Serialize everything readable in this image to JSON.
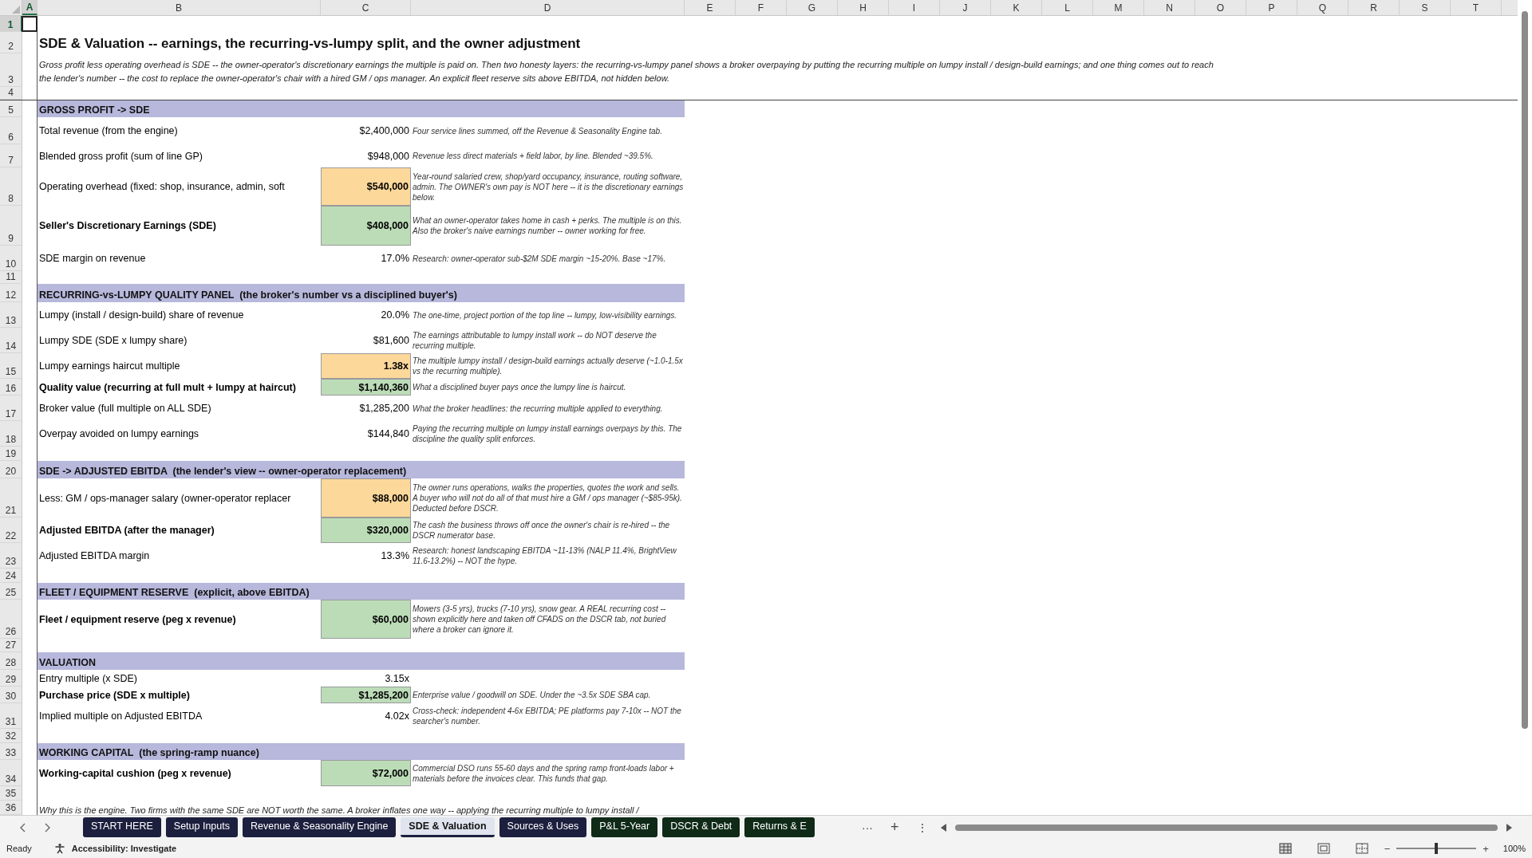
{
  "columns": [
    {
      "label": "A",
      "selected": true
    },
    {
      "label": "B",
      "selected": false
    },
    {
      "label": "C",
      "selected": false
    },
    {
      "label": "D",
      "selected": false
    },
    {
      "label": "E",
      "selected": false
    },
    {
      "label": "F",
      "selected": false
    },
    {
      "label": "G",
      "selected": false
    },
    {
      "label": "H",
      "selected": false
    },
    {
      "label": "I",
      "selected": false
    },
    {
      "label": "J",
      "selected": false
    },
    {
      "label": "K",
      "selected": false
    },
    {
      "label": "L",
      "selected": false
    },
    {
      "label": "M",
      "selected": false
    },
    {
      "label": "N",
      "selected": false
    },
    {
      "label": "O",
      "selected": false
    },
    {
      "label": "P",
      "selected": false
    },
    {
      "label": "Q",
      "selected": false
    },
    {
      "label": "R",
      "selected": false
    },
    {
      "label": "S",
      "selected": false
    },
    {
      "label": "T",
      "selected": false
    }
  ],
  "rows": [
    {
      "number": "1",
      "selected": true,
      "kind": "blank"
    },
    {
      "number": "2",
      "selected": false,
      "kind": "title",
      "text": "SDE & Valuation -- earnings, the recurring-vs-lumpy split, and the owner adjustment"
    },
    {
      "number": "3",
      "selected": false,
      "kind": "intro",
      "text": "Gross profit less operating overhead is SDE -- the owner-operator's discretionary earnings the multiple is paid on. Then two honesty layers: the recurring-vs-lumpy panel shows a broker overpaying by putting the recurring multiple on lumpy install / design-build earnings; and one thing comes out to reach the lender's number -- the cost to replace the owner-operator's chair with a hired GM / ops manager. An explicit fleet reserve sits above EBITDA, not hidden below."
    },
    {
      "number": "4",
      "selected": false,
      "kind": "divider"
    },
    {
      "number": "5",
      "selected": false,
      "kind": "section",
      "text": "GROSS PROFIT -> SDE"
    },
    {
      "number": "6",
      "selected": false,
      "kind": "line",
      "label": "Total revenue (from the engine)",
      "bold": false,
      "value": "$2,400,000",
      "note": "Four service lines summed, off the Revenue & Seasonality Engine tab."
    },
    {
      "number": "7",
      "selected": false,
      "kind": "line",
      "label": "Blended gross profit (sum of line GP)",
      "bold": false,
      "value": "$948,000",
      "note": "Revenue less direct materials + field labor, by line. Blended ~39.5%."
    },
    {
      "number": "8",
      "selected": false,
      "kind": "input-line",
      "label": "Operating overhead (fixed: shop, insurance, admin, soft",
      "bold": false,
      "value": "$540,000",
      "note": "Year-round salaried crew, shop/yard occupancy, insurance, routing software, admin. The OWNER's own pay is NOT here -- it is the discretionary earnings below."
    },
    {
      "number": "9",
      "selected": false,
      "kind": "output-line",
      "label": "Seller's Discretionary Earnings (SDE)",
      "bold": true,
      "value": "$408,000",
      "note": "What an owner-operator takes home in cash + perks. The multiple is on this. Also the broker's naive earnings number -- owner working for free."
    },
    {
      "number": "10",
      "selected": false,
      "kind": "line",
      "label": "SDE margin on revenue",
      "bold": false,
      "value": "17.0%",
      "note": "Research: owner-operator sub-$2M SDE margin ~15-20%. Base ~17%."
    },
    {
      "number": "11",
      "selected": false,
      "kind": "blank"
    },
    {
      "number": "12",
      "selected": false,
      "kind": "section",
      "text": "RECURRING-vs-LUMPY QUALITY PANEL  (the broker's number vs a disciplined buyer's)"
    },
    {
      "number": "13",
      "selected": false,
      "kind": "line",
      "label": "Lumpy (install / design-build) share of revenue",
      "bold": false,
      "value": "20.0%",
      "note": "The one-time, project portion of the top line -- lumpy, low-visibility earnings."
    },
    {
      "number": "14",
      "selected": false,
      "kind": "line",
      "label": "Lumpy SDE (SDE x lumpy share)",
      "bold": false,
      "value": "$81,600",
      "note": "The earnings attributable to lumpy install work -- do NOT deserve the recurring multiple."
    },
    {
      "number": "15",
      "selected": false,
      "kind": "input-line",
      "label": "Lumpy earnings haircut multiple",
      "bold": false,
      "value": "1.38x",
      "note": "The multiple lumpy install / design-build earnings actually deserve (~1.0-1.5x vs the recurring multiple)."
    },
    {
      "number": "16",
      "selected": false,
      "kind": "output-line",
      "label": "Quality value (recurring at full mult + lumpy at haircut)",
      "bold": true,
      "value": "$1,140,360",
      "note": "What a disciplined buyer pays once the lumpy line is haircut."
    },
    {
      "number": "17",
      "selected": false,
      "kind": "line",
      "label": "Broker value (full multiple on ALL SDE)",
      "bold": false,
      "value": "$1,285,200",
      "note": "What the broker headlines: the recurring multiple applied to everything."
    },
    {
      "number": "18",
      "selected": false,
      "kind": "line",
      "label": "Overpay avoided on lumpy earnings",
      "bold": false,
      "value": "$144,840",
      "note": "Paying the recurring multiple on lumpy install earnings overpays by this. The discipline the quality split enforces."
    },
    {
      "number": "19",
      "selected": false,
      "kind": "blank"
    },
    {
      "number": "20",
      "selected": false,
      "kind": "section",
      "text": "SDE -> ADJUSTED EBITDA  (the lender's view -- owner-operator replacement)"
    },
    {
      "number": "21",
      "selected": false,
      "kind": "input-line",
      "label": "Less: GM / ops-manager salary (owner-operator replacer",
      "bold": false,
      "value": "$88,000",
      "note": "The owner runs operations, walks the properties, quotes the work and sells. A buyer who will not do all of that must hire a GM / ops manager (~$85-95k). Deducted before DSCR."
    },
    {
      "number": "22",
      "selected": false,
      "kind": "output-line",
      "label": "Adjusted EBITDA (after the manager)",
      "bold": true,
      "value": "$320,000",
      "note": "The cash the business throws off once the owner's chair is re-hired -- the DSCR numerator base."
    },
    {
      "number": "23",
      "selected": false,
      "kind": "line",
      "label": "Adjusted EBITDA margin",
      "bold": false,
      "value": "13.3%",
      "note": "Research: honest landscaping EBITDA ~11-13% (NALP 11.4%, BrightView 11.6-13.2%) -- NOT the hype."
    },
    {
      "number": "24",
      "selected": false,
      "kind": "blank"
    },
    {
      "number": "25",
      "selected": false,
      "kind": "section",
      "text": "FLEET / EQUIPMENT RESERVE  (explicit, above EBITDA)"
    },
    {
      "number": "26",
      "selected": false,
      "kind": "output-line",
      "label": "Fleet / equipment reserve (peg x revenue)",
      "bold": true,
      "value": "$60,000",
      "note": "Mowers (3-5 yrs), trucks (7-10 yrs), snow gear. A REAL recurring cost -- shown explicitly here and taken off CFADS on the DSCR tab, not buried where a broker can ignore it."
    },
    {
      "number": "27",
      "selected": false,
      "kind": "blank"
    },
    {
      "number": "28",
      "selected": false,
      "kind": "section",
      "text": "VALUATION"
    },
    {
      "number": "29",
      "selected": false,
      "kind": "line",
      "label": "Entry multiple (x SDE)",
      "bold": false,
      "value": "3.15x"
    },
    {
      "number": "30",
      "selected": false,
      "kind": "output-line",
      "label": "Purchase price (SDE x multiple)",
      "bold": true,
      "value": "$1,285,200",
      "note": "Enterprise value / goodwill on SDE. Under the ~3.5x SDE SBA cap."
    },
    {
      "number": "31",
      "selected": false,
      "kind": "line",
      "label": "Implied multiple on Adjusted EBITDA",
      "bold": false,
      "value": "4.02x",
      "note": "Cross-check: independent 4-6x EBITDA; PE platforms pay 7-10x -- NOT the searcher's number."
    },
    {
      "number": "32",
      "selected": false,
      "kind": "blank"
    },
    {
      "number": "33",
      "selected": false,
      "kind": "section",
      "text": "WORKING CAPITAL  (the spring-ramp nuance)"
    },
    {
      "number": "34",
      "selected": false,
      "kind": "output-line",
      "label": "Working-capital cushion (peg x revenue)",
      "bold": true,
      "value": "$72,000",
      "note": "Commercial DSO runs 55-60 days and the spring ramp front-loads labor + materials before the invoices clear. This funds that gap."
    },
    {
      "number": "35",
      "selected": false,
      "kind": "blank"
    },
    {
      "number": "36",
      "selected": false,
      "kind": "closing",
      "text": "Why this is the engine. Two firms with the same SDE are NOT worth the same. A broker inflates one way -- applying the recurring multiple to lumpy install /"
    }
  ],
  "sheet_tabs": [
    {
      "label": "START HERE",
      "selected": false,
      "color": "#1c1f3d"
    },
    {
      "label": "Setup Inputs",
      "selected": false,
      "color": "#1c1f3d"
    },
    {
      "label": "Revenue & Seasonality Engine",
      "selected": false,
      "color": "#1c1f3d"
    },
    {
      "label": "SDE & Valuation",
      "selected": true,
      "color": "#1c1f3d"
    },
    {
      "label": "Sources & Uses",
      "selected": false,
      "color": "#1c1f3d"
    },
    {
      "label": "P&L 5-Year",
      "selected": false,
      "color": "#0f2a17"
    },
    {
      "label": "DSCR & Debt",
      "selected": false,
      "color": "#0f2a17"
    },
    {
      "label": "Returns & E",
      "selected": false,
      "color": "#0f2a17"
    }
  ],
  "tab_controls": {
    "more": "···",
    "add": "+",
    "menu": "⋮"
  },
  "status_bar": {
    "status": "Ready",
    "accessibility": "Accessibility: Investigate",
    "zoom_out": "−",
    "zoom_in": "+",
    "zoom_slider": {
      "level": 0.5
    },
    "zoom": "100%"
  }
}
